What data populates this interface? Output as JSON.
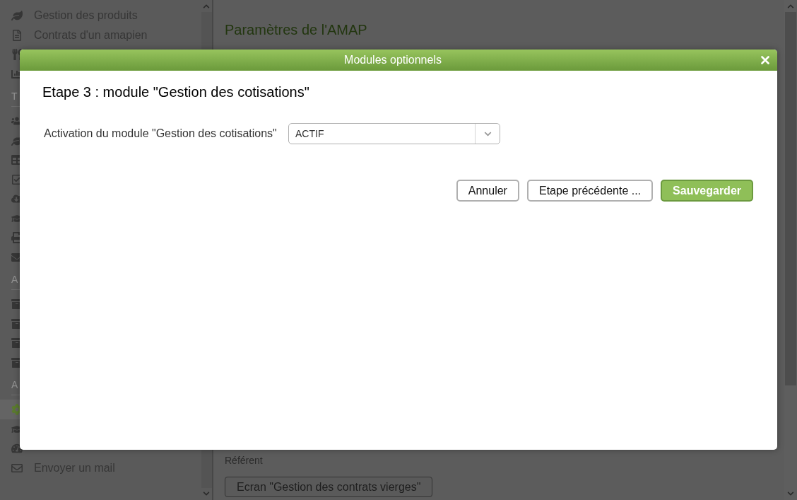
{
  "sidebar": {
    "groups": [
      {
        "items": [
          {
            "label": "Gestion des produits",
            "selected": false
          },
          {
            "label": "Contrats d'un amapien",
            "selected": false
          },
          {
            "selected": false
          },
          {
            "selected": false
          }
        ]
      },
      {
        "heading": "T",
        "items": [
          {
            "selected": false
          },
          {
            "selected": false
          },
          {
            "selected": false
          },
          {
            "selected": false
          },
          {
            "selected": false
          },
          {
            "selected": false
          },
          {
            "selected": false
          },
          {
            "selected": false
          }
        ]
      },
      {
        "heading": "A",
        "items": [
          {
            "selected": false
          },
          {
            "selected": false
          },
          {
            "selected": false
          },
          {
            "selected": false
          }
        ]
      },
      {
        "heading": "A",
        "items": [
          {
            "selected": true
          },
          {
            "selected": false
          },
          {
            "selected": false
          },
          {
            "label": "Envoyer un mail",
            "selected": false
          }
        ]
      }
    ]
  },
  "main": {
    "title": "Paramètres de l'AMAP",
    "field_label": "Référent",
    "button": "Ecran \"Gestion des contrats vierges\""
  },
  "dialog": {
    "title": "Modules optionnels",
    "step_title": "Etape 3 : module \"Gestion des cotisations\"",
    "fields": [
      {
        "label": "Activation du module \"Gestion des cotisations\"",
        "value": "ACTIF"
      }
    ],
    "buttons": [
      {
        "label": "Annuler",
        "kind": "default"
      },
      {
        "label": "Etape précédente ...",
        "kind": "default"
      },
      {
        "label": "Sauvegarder",
        "kind": "primary"
      }
    ]
  }
}
